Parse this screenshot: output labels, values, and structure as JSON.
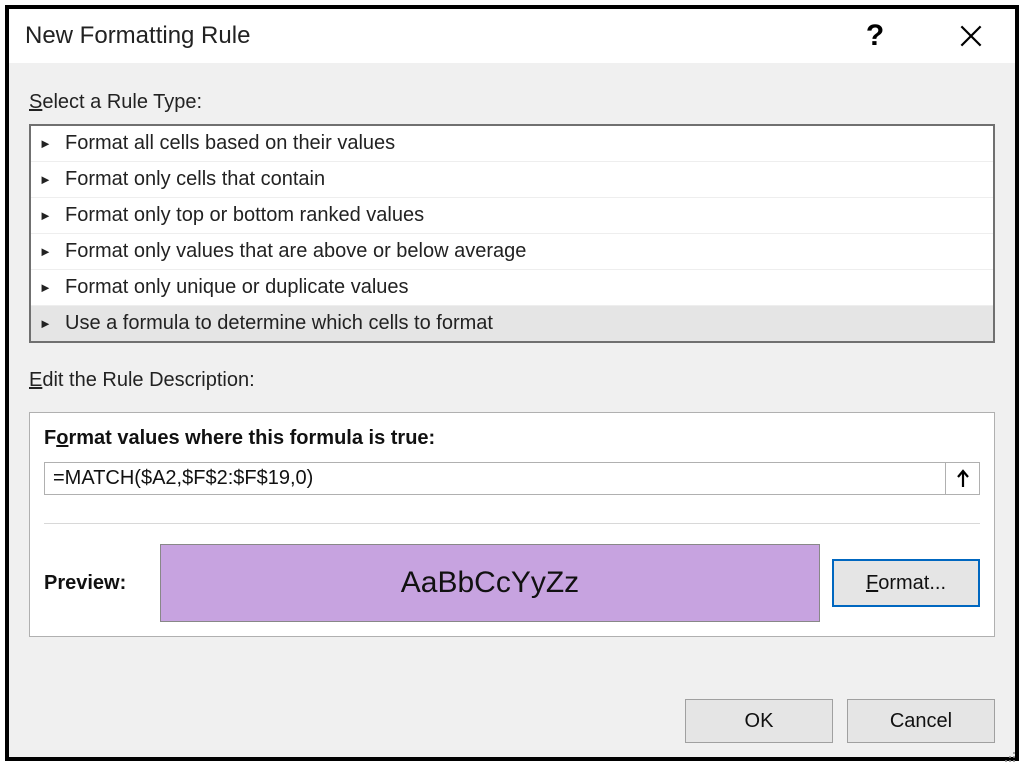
{
  "titlebar": {
    "title": "New Formatting Rule",
    "help_icon": "?",
    "close_icon": "close"
  },
  "sections": {
    "rule_type_label_pre": "S",
    "rule_type_label_post": "elect a Rule Type:",
    "rule_desc_label_pre": "E",
    "rule_desc_label_post": "dit the Rule Description:"
  },
  "rule_types": [
    {
      "label": "Format all cells based on their values",
      "selected": false
    },
    {
      "label": "Format only cells that contain",
      "selected": false
    },
    {
      "label": "Format only top or bottom ranked values",
      "selected": false
    },
    {
      "label": "Format only values that are above or below average",
      "selected": false
    },
    {
      "label": "Format only unique or duplicate values",
      "selected": false
    },
    {
      "label": "Use a formula to determine which cells to format",
      "selected": true
    }
  ],
  "desc": {
    "heading_pre": "F",
    "heading_u": "o",
    "heading_post": "rmat values where this formula is true:",
    "formula": "=MATCH($A2,$F$2:$F$19,0)",
    "preview_label": "Preview:",
    "preview_text": "AaBbCcYyZz",
    "preview_fill": "#c7a3e0",
    "format_btn_pre": "",
    "format_btn_u": "F",
    "format_btn_post": "ormat..."
  },
  "buttons": {
    "ok": "OK",
    "cancel": "Cancel"
  }
}
